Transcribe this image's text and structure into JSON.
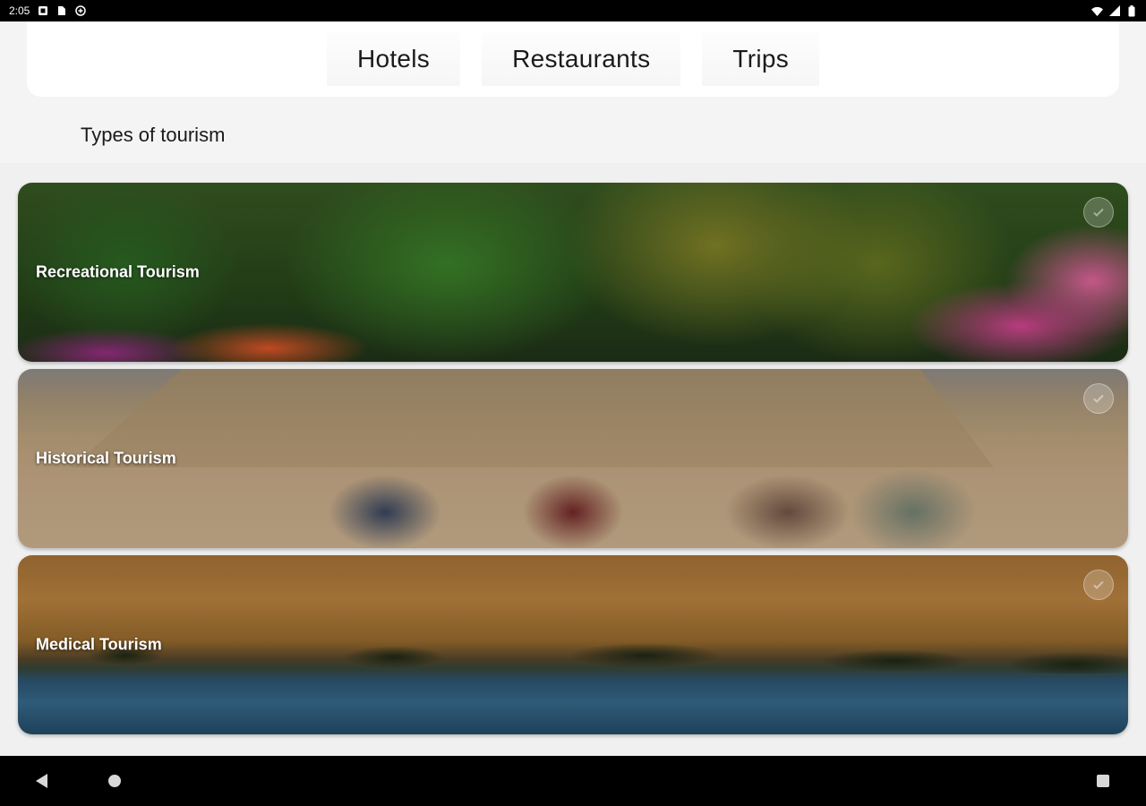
{
  "status_bar": {
    "time": "2:05",
    "icons": [
      "notification-icon",
      "sim-card-icon",
      "data-saver-icon"
    ],
    "right_icons": [
      "wifi-icon",
      "signal-icon",
      "battery-icon"
    ]
  },
  "tabs": [
    {
      "label": "Hotels"
    },
    {
      "label": "Restaurants"
    },
    {
      "label": "Trips"
    }
  ],
  "section_title": "Types of tourism",
  "cards": [
    {
      "label": "Recreational Tourism",
      "image": "garden-flowers-photo"
    },
    {
      "label": "Historical Tourism",
      "image": "pyramids-camels-photo"
    },
    {
      "label": "Medical Tourism",
      "image": "desert-oasis-photo"
    }
  ],
  "nav": [
    "back-icon",
    "home-icon",
    "recents-icon"
  ]
}
